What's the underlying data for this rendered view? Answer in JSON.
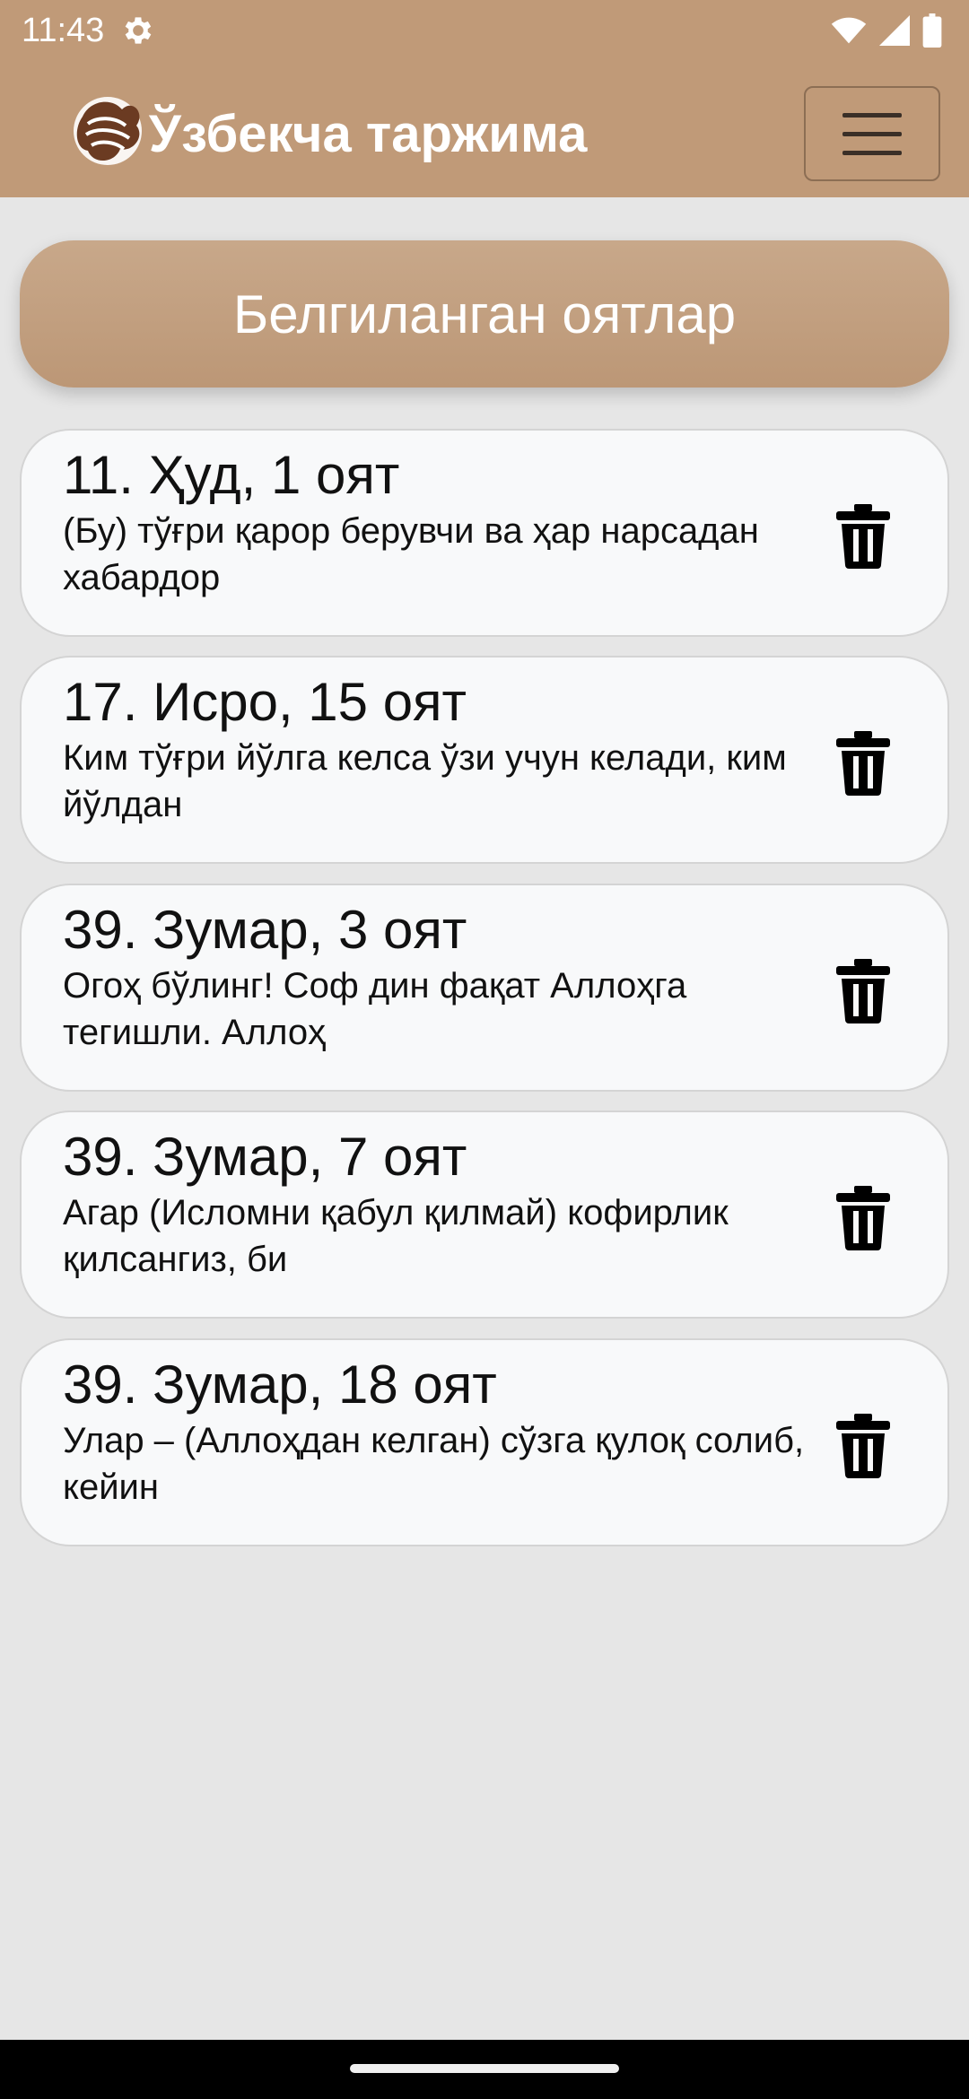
{
  "status_bar": {
    "time": "11:43",
    "icons": [
      "gear-icon",
      "wifi-icon",
      "cell-signal-icon",
      "battery-icon"
    ]
  },
  "app_bar": {
    "title": "Ўзбекча таржима",
    "logo_icon": "logo-icon",
    "menu_icon": "hamburger-menu-icon",
    "background_color": "#c09a78"
  },
  "section": {
    "label": "Белгиланган оятлар"
  },
  "bookmarks": [
    {
      "title": "11. Ҳуд, 1 оят",
      "text": "(Бу) тўғри қарор берувчи ва ҳар нарсадан хабардор"
    },
    {
      "title": "17. Исро, 15 оят",
      "text": "Ким тўғри йўлга келса ўзи учун келади, ким йўлдан"
    },
    {
      "title": "39. Зумар, 3 оят",
      "text": "Огоҳ бўлинг! Соф дин фақат Аллоҳга тегишли. Аллоҳ"
    },
    {
      "title": "39. Зумар, 7 оят",
      "text": "Агар (Исломни қабул қилмай) кофирлик қилсангиз, би"
    },
    {
      "title": "39. Зумар, 18 оят",
      "text": "Улар – (Аллоҳдан келган) сўзга қулоқ солиб, кейин"
    }
  ],
  "colors": {
    "accent": "#c09a78",
    "page_background": "#e6e6e6",
    "card_background": "#f8f9fa"
  }
}
